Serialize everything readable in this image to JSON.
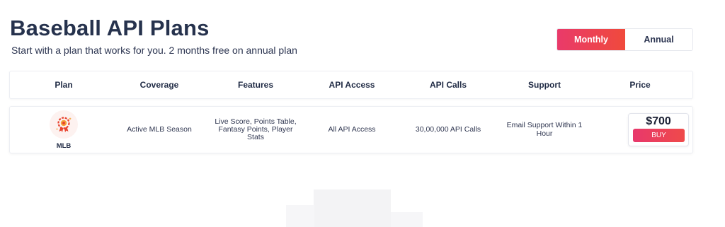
{
  "page": {
    "title": "Baseball API Plans",
    "subtitle": "Start with a plan that works for you. 2 months free on annual plan"
  },
  "billing_toggle": {
    "monthly_label": "Monthly",
    "annual_label": "Annual",
    "selected": "Monthly"
  },
  "table": {
    "headers": [
      "Plan",
      "Coverage",
      "Features",
      "API Access",
      "API Calls",
      "Support",
      "Price"
    ],
    "rows": [
      {
        "plan": "MLB",
        "coverage": "Active MLB Season",
        "features": "Live Score, Points Table, Fantasy Points, Player Stats",
        "api_access": "All API Access",
        "api_calls": "30,00,000 API Calls",
        "support": "Email Support Within 1 Hour",
        "price": "$700",
        "buy_label": "BUY"
      }
    ]
  },
  "colors": {
    "accent_start": "#e93a6a",
    "accent_end": "#f04a3c",
    "heading": "#26324d"
  },
  "icons": {
    "plan_icon": "award-medal-icon"
  }
}
